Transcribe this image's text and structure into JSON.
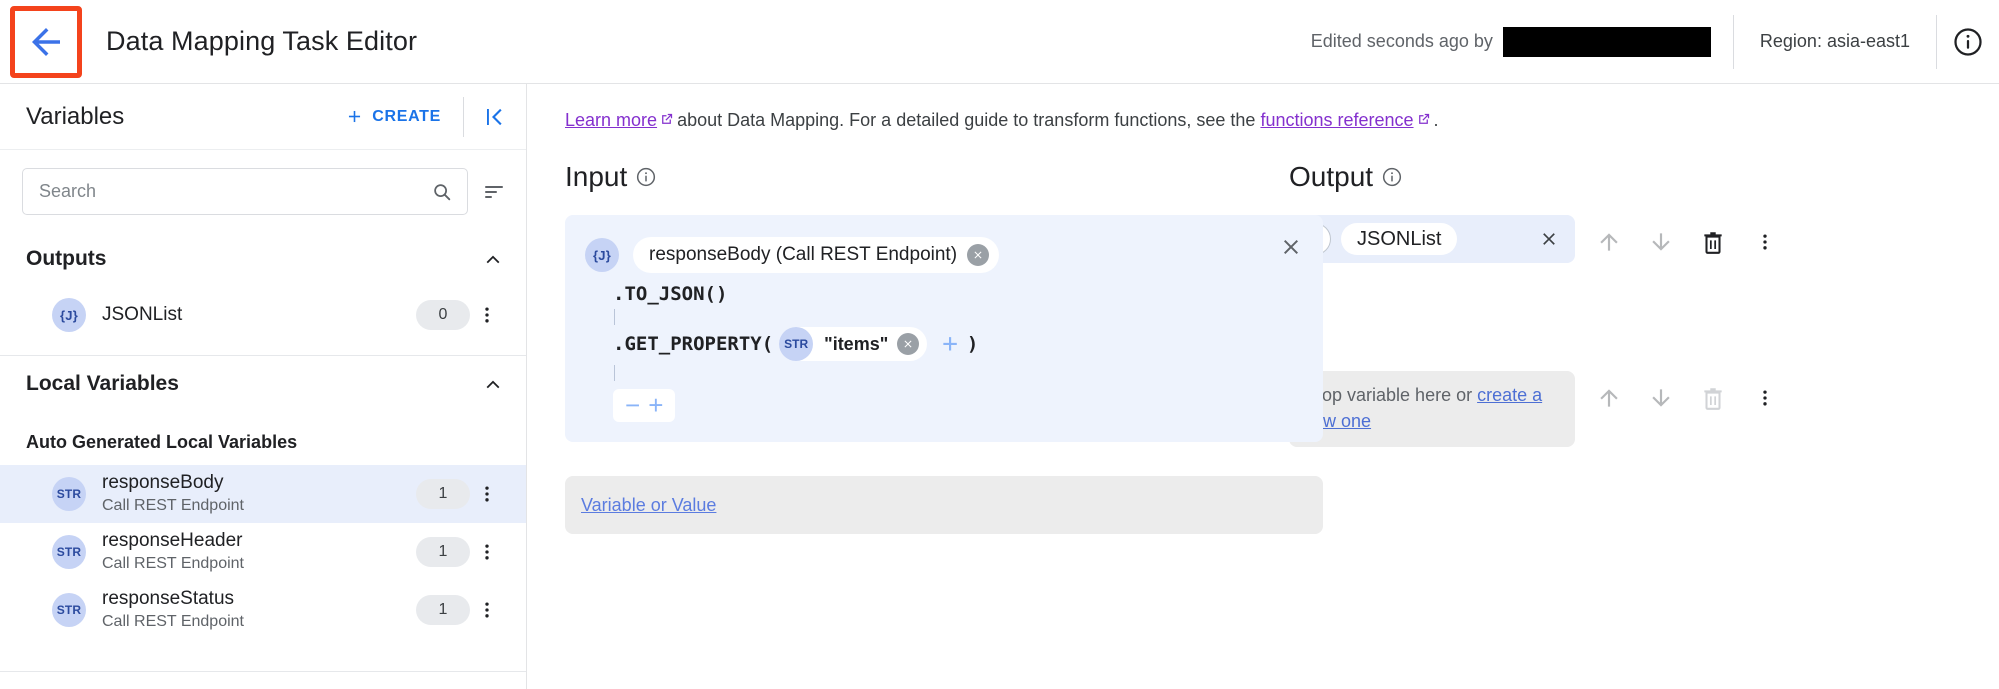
{
  "topbar": {
    "back_icon": "arrow-left-icon",
    "title": "Data Mapping Task Editor",
    "edited_text": "Edited seconds ago by",
    "region_text": "Region: asia-east1",
    "info_icon": "info-icon",
    "highlight_color": "#f4431c"
  },
  "sidebar": {
    "title": "Variables",
    "create_label": "CREATE",
    "collapse_icon": "collapse-panel-icon",
    "search": {
      "placeholder": "Search",
      "value": "",
      "search_icon": "search-icon",
      "sort_icon": "sort-filter-icon"
    },
    "sections": [
      {
        "label": "Outputs",
        "chevron": "chevron-up-icon",
        "items": [
          {
            "badge": "{J}",
            "name": "JSONList",
            "sub": "",
            "count": "0"
          }
        ]
      },
      {
        "label": "Local Variables",
        "chevron": "chevron-up-icon",
        "subheading": "Auto Generated Local Variables",
        "items": [
          {
            "badge": "STR",
            "name": "responseBody",
            "sub": "Call REST Endpoint",
            "count": "1",
            "selected": true
          },
          {
            "badge": "STR",
            "name": "responseHeader",
            "sub": "Call REST Endpoint",
            "count": "1",
            "selected": false
          },
          {
            "badge": "STR",
            "name": "responseStatus",
            "sub": "Call REST Endpoint",
            "count": "1",
            "selected": false
          }
        ]
      }
    ]
  },
  "main": {
    "learn": {
      "link1": "Learn more",
      "mid": "about Data Mapping. For a detailed guide to transform functions, see the",
      "link2": "functions reference",
      "end": ".",
      "link_color": "#8430ce"
    },
    "input": {
      "title": "Input",
      "info_icon": "info-icon",
      "card": {
        "badge": "{J}",
        "chip_label": "responseBody (Call REST Endpoint)",
        "chip_remove_icon": "chip-remove-icon",
        "close_icon": "close-icon",
        "functions": [
          {
            "name": ".TO_JSON(",
            "close": ")"
          },
          {
            "name": ".GET_PROPERTY(",
            "close": ")"
          }
        ],
        "arg": {
          "badge": "STR",
          "value": "\"items\"",
          "remove_icon": "chip-remove-icon"
        },
        "add_arg_label": "+",
        "stepper_minus": "−",
        "stepper_plus": "+"
      },
      "value_row": {
        "label": "Variable or Value"
      }
    },
    "output": {
      "title": "Output",
      "info_icon": "info-icon",
      "rows": [
        {
          "type": "filled",
          "badge": "{J}",
          "name": "JSONList",
          "clear_icon": "close-icon",
          "tools": {
            "move_up": "arrow-up-icon",
            "move_down": "arrow-down-icon",
            "delete": "trash-icon",
            "more": "more-vert-icon"
          },
          "delete_enabled": true
        },
        {
          "type": "empty",
          "placeholder_prefix": "Drop variable here or ",
          "placeholder_link": "create a new one",
          "tools": {
            "move_up": "arrow-up-icon",
            "move_down": "arrow-down-icon",
            "delete": "trash-icon",
            "more": "more-vert-icon"
          },
          "delete_enabled": false
        }
      ]
    },
    "arrow_icon": "arrow-right-icon"
  }
}
